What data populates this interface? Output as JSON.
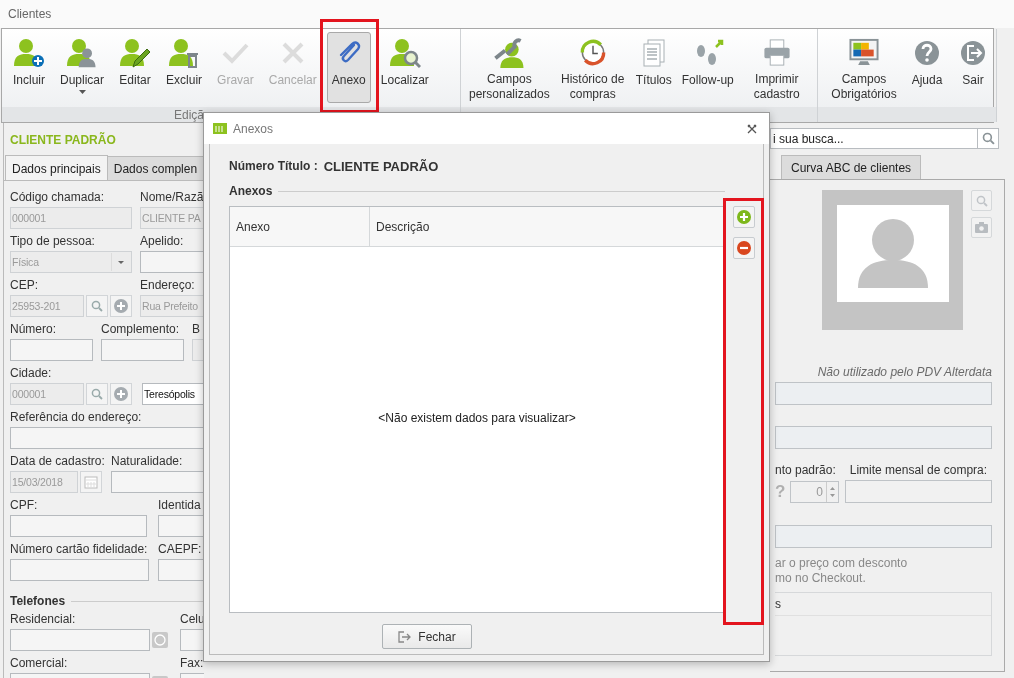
{
  "window": {
    "title": "Clientes"
  },
  "ribbon": {
    "groups": [
      {
        "label": "Ediçã",
        "buttons": [
          {
            "label": "Incluir",
            "kind": "include",
            "disabled": false,
            "pressed": false
          },
          {
            "label": "Duplicar",
            "kind": "duplicate",
            "disabled": false,
            "pressed": false,
            "dropdown": true
          },
          {
            "label": "Editar",
            "kind": "edit",
            "disabled": false,
            "pressed": false
          },
          {
            "label": "Excluir",
            "kind": "delete",
            "disabled": false,
            "pressed": false
          },
          {
            "label": "Gravar",
            "kind": "save",
            "disabled": true,
            "pressed": false
          },
          {
            "label": "Cancelar",
            "kind": "cancel",
            "disabled": true,
            "pressed": false
          },
          {
            "label": "Anexo",
            "kind": "attach",
            "disabled": false,
            "pressed": true,
            "highlighted": true
          },
          {
            "label": "Localizar",
            "kind": "find",
            "disabled": false,
            "pressed": false
          }
        ]
      },
      {
        "buttons": [
          {
            "label": "Campos personalizados",
            "kind": "fields",
            "disabled": false,
            "pressed": false
          },
          {
            "label": "Histórico de compras",
            "kind": "history",
            "disabled": false,
            "pressed": false
          },
          {
            "label": "Títulos",
            "kind": "titles",
            "disabled": false,
            "pressed": false
          },
          {
            "label": "Follow-up",
            "kind": "followup",
            "disabled": false,
            "pressed": false
          },
          {
            "label": "Imprimir cadastro",
            "kind": "print",
            "disabled": false,
            "pressed": false
          }
        ]
      },
      {
        "buttons": [
          {
            "label": "Campos Obrigatórios",
            "kind": "required",
            "disabled": false,
            "pressed": false
          },
          {
            "label": "Ajuda",
            "kind": "help",
            "disabled": false,
            "pressed": false
          },
          {
            "label": "Sair",
            "kind": "exit",
            "disabled": false,
            "pressed": false
          }
        ]
      }
    ]
  },
  "client_panel": {
    "title": "CLIENTE PADRÃO",
    "tabs": [
      {
        "label": "Dados principais",
        "selected": true
      },
      {
        "label": "Dados complen",
        "selected": false
      }
    ],
    "rows": [
      [
        {
          "label": "Código chamada:",
          "value": "000001",
          "disabled": true,
          "kind": "text"
        },
        {
          "label": "Nome/Razã",
          "value": "CLIENTE PA",
          "disabled": true,
          "kind": "text"
        }
      ],
      [
        {
          "label": "Tipo de pessoa:",
          "value": "Física",
          "disabled": true,
          "kind": "select"
        },
        {
          "label": "Apelido:",
          "disabled": false,
          "kind": "text"
        }
      ],
      [
        {
          "label": "CEP:",
          "value": "25953-201",
          "disabled": true,
          "kind": "lookup"
        },
        {
          "label": "Endereço:",
          "value": "Rua Prefeito",
          "disabled": true,
          "kind": "text"
        }
      ],
      [
        {
          "label": "Número:",
          "disabled": false,
          "kind": "text"
        },
        {
          "label": "Complemento:",
          "disabled": false,
          "kind": "text"
        },
        {
          "label": "B",
          "disabled": true,
          "kind": "text"
        }
      ],
      [
        {
          "label": "Cidade:",
          "value": "000001",
          "disabled": true,
          "kind": "lookup"
        },
        {
          "value": "Teresópolis",
          "disabled": false,
          "kind": "text"
        }
      ],
      [
        {
          "label": "Referência do endereço:",
          "disabled": false,
          "kind": "text"
        }
      ],
      [
        {
          "label": "Data de cadastro:",
          "value": "15/03/2018",
          "disabled": true,
          "kind": "date"
        },
        {
          "label": "Naturalidade:",
          "disabled": false,
          "kind": "text"
        }
      ],
      [
        {
          "label": "CPF:",
          "disabled": false,
          "kind": "text"
        },
        {
          "label": "Identida",
          "disabled": false,
          "kind": "text"
        }
      ],
      [
        {
          "label": "Número cartão fidelidade:",
          "disabled": false,
          "kind": "text"
        },
        {
          "label": "CAEPF:",
          "disabled": false,
          "kind": "text"
        }
      ],
      [
        {
          "label": "Residencial:",
          "disabled": false,
          "kind": "phone"
        },
        {
          "label": "Celu",
          "disabled": false,
          "kind": "text"
        }
      ],
      [
        {
          "label": "Comercial:",
          "disabled": false,
          "kind": "phone"
        },
        {
          "label": "Fax:",
          "disabled": false,
          "kind": "text"
        }
      ]
    ],
    "section": "Telefones"
  },
  "right_panel": {
    "search": {
      "placeholder": "i sua busca..."
    },
    "tabs": [
      {
        "label": "Curva ABC de clientes",
        "selected": false
      }
    ],
    "note": "Não utilizado pelo PDV Alterdata",
    "discount_label": "nto padrão:",
    "limit_label": "Limite mensal de compra:",
    "help_mark": "?",
    "discount_value": "0",
    "hint_lines": [
      "ar o preço com desconto",
      "mo no Checkout."
    ],
    "group_title": "s"
  },
  "dialog": {
    "title": "Anexos",
    "number_label": "Número Título :",
    "number_value": "CLIENTE PADRÃO",
    "section": "Anexos",
    "table": {
      "columns": [
        "Anexo",
        "Descrição"
      ],
      "empty_text": "<Não existem dados para visualizar>"
    },
    "side_buttons": {
      "highlighted": true,
      "items": [
        {
          "kind": "add"
        },
        {
          "kind": "remove"
        }
      ]
    },
    "close_button": "Fechar"
  }
}
